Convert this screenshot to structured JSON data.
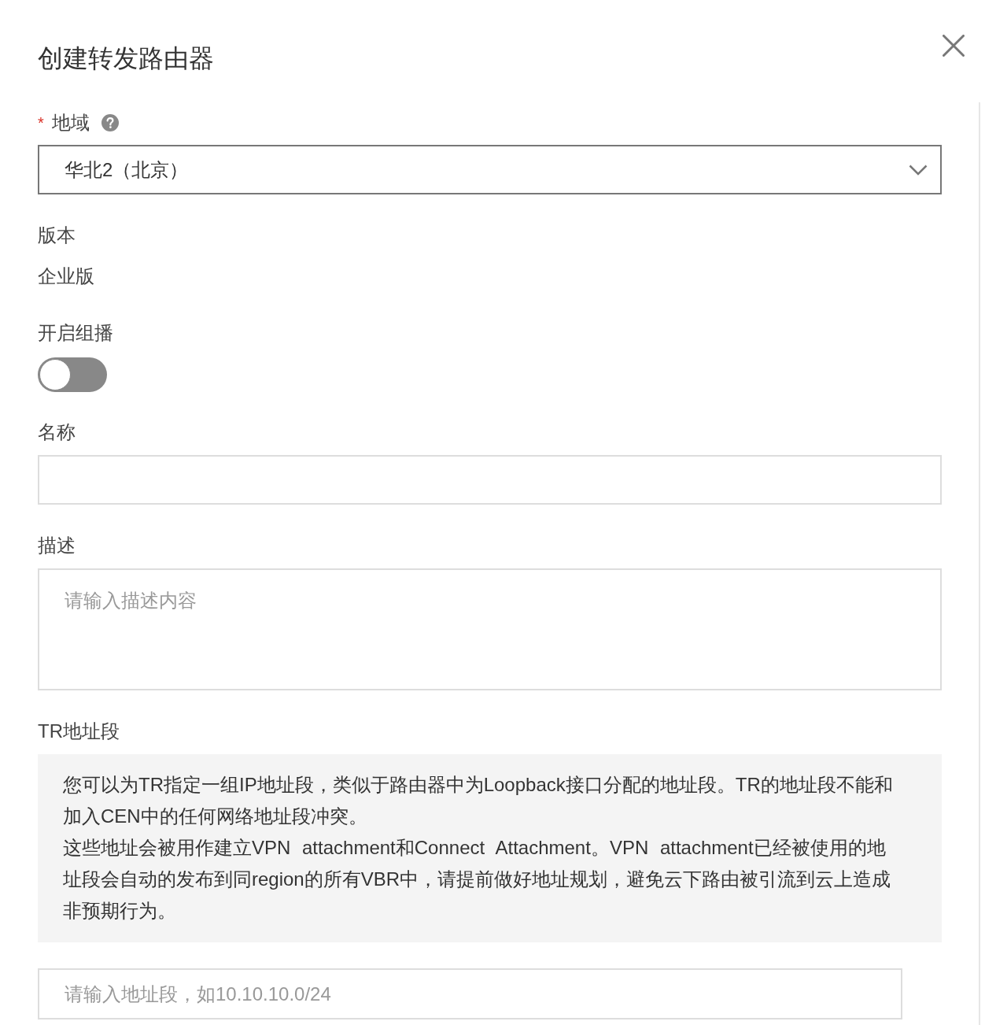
{
  "dialog": {
    "title": "创建转发路由器"
  },
  "region": {
    "required_mark": "*",
    "label": "地域",
    "value": "华北2（北京）"
  },
  "edition": {
    "label": "版本",
    "value": "企业版"
  },
  "multicast": {
    "label": "开启组播",
    "on": false
  },
  "name": {
    "label": "名称"
  },
  "description": {
    "label": "描述",
    "placeholder": "请输入描述内容"
  },
  "tr_cidr": {
    "label": "TR地址段",
    "notice": [
      "您可以为TR指定一组IP地址段，类似于路由器中为Loopback接口分配的地址段。TR的地址段不能和加入CEN中的任何网络地址段冲突。",
      "这些地址会被用作建立VPN attachment和Connect Attachment。VPN attachment已经被使用的地址段会自动的发布到同region的所有VBR中，请提前做好地址规划，避免云下路由被引流到云上造成非预期行为。"
    ],
    "placeholder": "请输入地址段，如10.10.10.0/24"
  }
}
